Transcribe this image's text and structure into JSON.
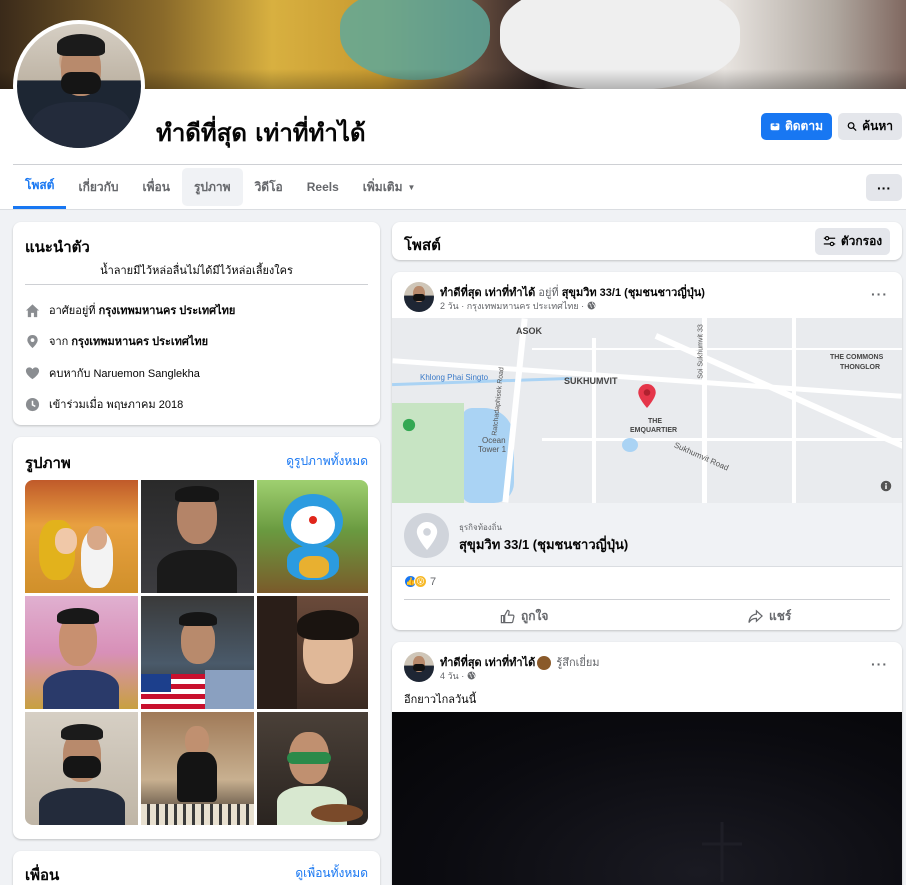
{
  "profile": {
    "name": "ทำดีที่สุด เท่าที่ทำได้",
    "follow_label": "ติดตาม",
    "search_label": "ค้นหา"
  },
  "tabs": [
    {
      "label": "โพสต์",
      "active": true
    },
    {
      "label": "เกี่ยวกับ"
    },
    {
      "label": "เพื่อน"
    },
    {
      "label": "รูปภาพ"
    },
    {
      "label": "วิดีโอ"
    },
    {
      "label": "Reels"
    },
    {
      "label": "เพิ่มเติม"
    }
  ],
  "intro": {
    "title": "แนะนำตัว",
    "bio": "น้ำลายมีไว้หล่อลื่นไม่ได้มีไว้หล่อเลี้ยงใคร",
    "lives_prefix": "อาศัยอยู่ที่",
    "lives": "กรุงเทพมหานคร ประเทศไทย",
    "from_prefix": "จาก",
    "from": "กรุงเทพมหานคร ประเทศไทย",
    "relationship": "คบหากับ Naruemon Sanglekha",
    "joined": "เข้าร่วมเมื่อ พฤษภาคม 2018"
  },
  "photos": {
    "title": "รูปภาพ",
    "see_all": "ดูรูปภาพทั้งหมด"
  },
  "friends": {
    "title": "เพื่อน",
    "see_all": "ดูเพื่อนทั้งหมด"
  },
  "posts": {
    "title": "โพสต์",
    "filter_label": "ตัวกรอง"
  },
  "post1": {
    "author": "ทำดีที่สุด เท่าที่ทำได้",
    "at_text": "อยู่ที่",
    "location": "สุขุมวิท 33/1 (ชุมชนชาวญี่ปุ่น)",
    "meta": "2 วัน · กรุงเทพมหานคร ประเทศไทย ·",
    "map_labels": {
      "asok": "ASOK",
      "sukhumvit": "SUKHUMVIT",
      "khlong": "Khlong Phai Singto",
      "commons": "THE COMMONS",
      "thonglor": "THONGLOR",
      "emquartier_1": "THE",
      "emquartier_2": "EMQUARTIER",
      "ocean": "Ocean",
      "tower": "Tower 1",
      "ratchada": "Ratchadaphisek Road",
      "sukhumvit_road": "Sukhumvit Road",
      "soi_sukhumvit": "Soi Sukhumvit 33"
    },
    "place_category": "ธุรกิจท้องถิ่น",
    "place_name": "สุขุมวิท 33/1 (ชุมชนชาวญี่ปุ่น)",
    "reaction_count": "7",
    "like_label": "ถูกใจ",
    "share_label": "แชร์"
  },
  "post2": {
    "author": "ทำดีที่สุด เท่าที่ทำได้",
    "feeling": "รู้สึกเยี่ยม",
    "meta": "4 วัน ·",
    "text": "อีกยาวไกลวันนี้"
  },
  "colors": {
    "accent": "#1877f2",
    "background": "#f0f2f5"
  }
}
